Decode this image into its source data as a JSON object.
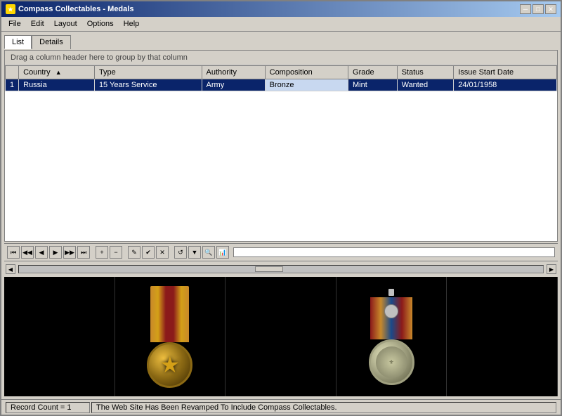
{
  "window": {
    "title": "Compass Collectables - Medals",
    "icon": "★"
  },
  "title_buttons": {
    "minimize": "─",
    "maximize": "□",
    "close": "✕"
  },
  "menu": {
    "items": [
      "File",
      "Edit",
      "Layout",
      "Options",
      "Help"
    ]
  },
  "tabs": [
    {
      "label": "List",
      "active": true
    },
    {
      "label": "Details",
      "active": false
    }
  ],
  "group_hint": "Drag a column header here to group by that column",
  "table": {
    "columns": [
      {
        "label": "Country",
        "sort": true
      },
      {
        "label": "Type"
      },
      {
        "label": "Authority"
      },
      {
        "label": "Composition"
      },
      {
        "label": "Grade"
      },
      {
        "label": "Status"
      },
      {
        "label": "Issue Start Date"
      }
    ],
    "rows": [
      {
        "num": "1",
        "country": "Russia",
        "type": "15 Years Service",
        "authority": "Army",
        "composition": "Bronze",
        "grade": "Mint",
        "status": "Wanted",
        "issue_start_date": "24/01/1958"
      }
    ]
  },
  "nav_buttons": [
    "⏮",
    "◀",
    "▶",
    "⏭",
    "⏭+",
    "➕",
    "➖",
    "✎",
    "✔",
    "✕",
    "🔄",
    "📋",
    "🔍",
    "📊"
  ],
  "status": {
    "record_count": "Record Count = 1",
    "message": "The Web Site Has Been Revamped To Include Compass Collectables."
  },
  "images": [
    {
      "type": "medal",
      "position": "left"
    },
    {
      "type": "medal",
      "position": "right"
    }
  ]
}
